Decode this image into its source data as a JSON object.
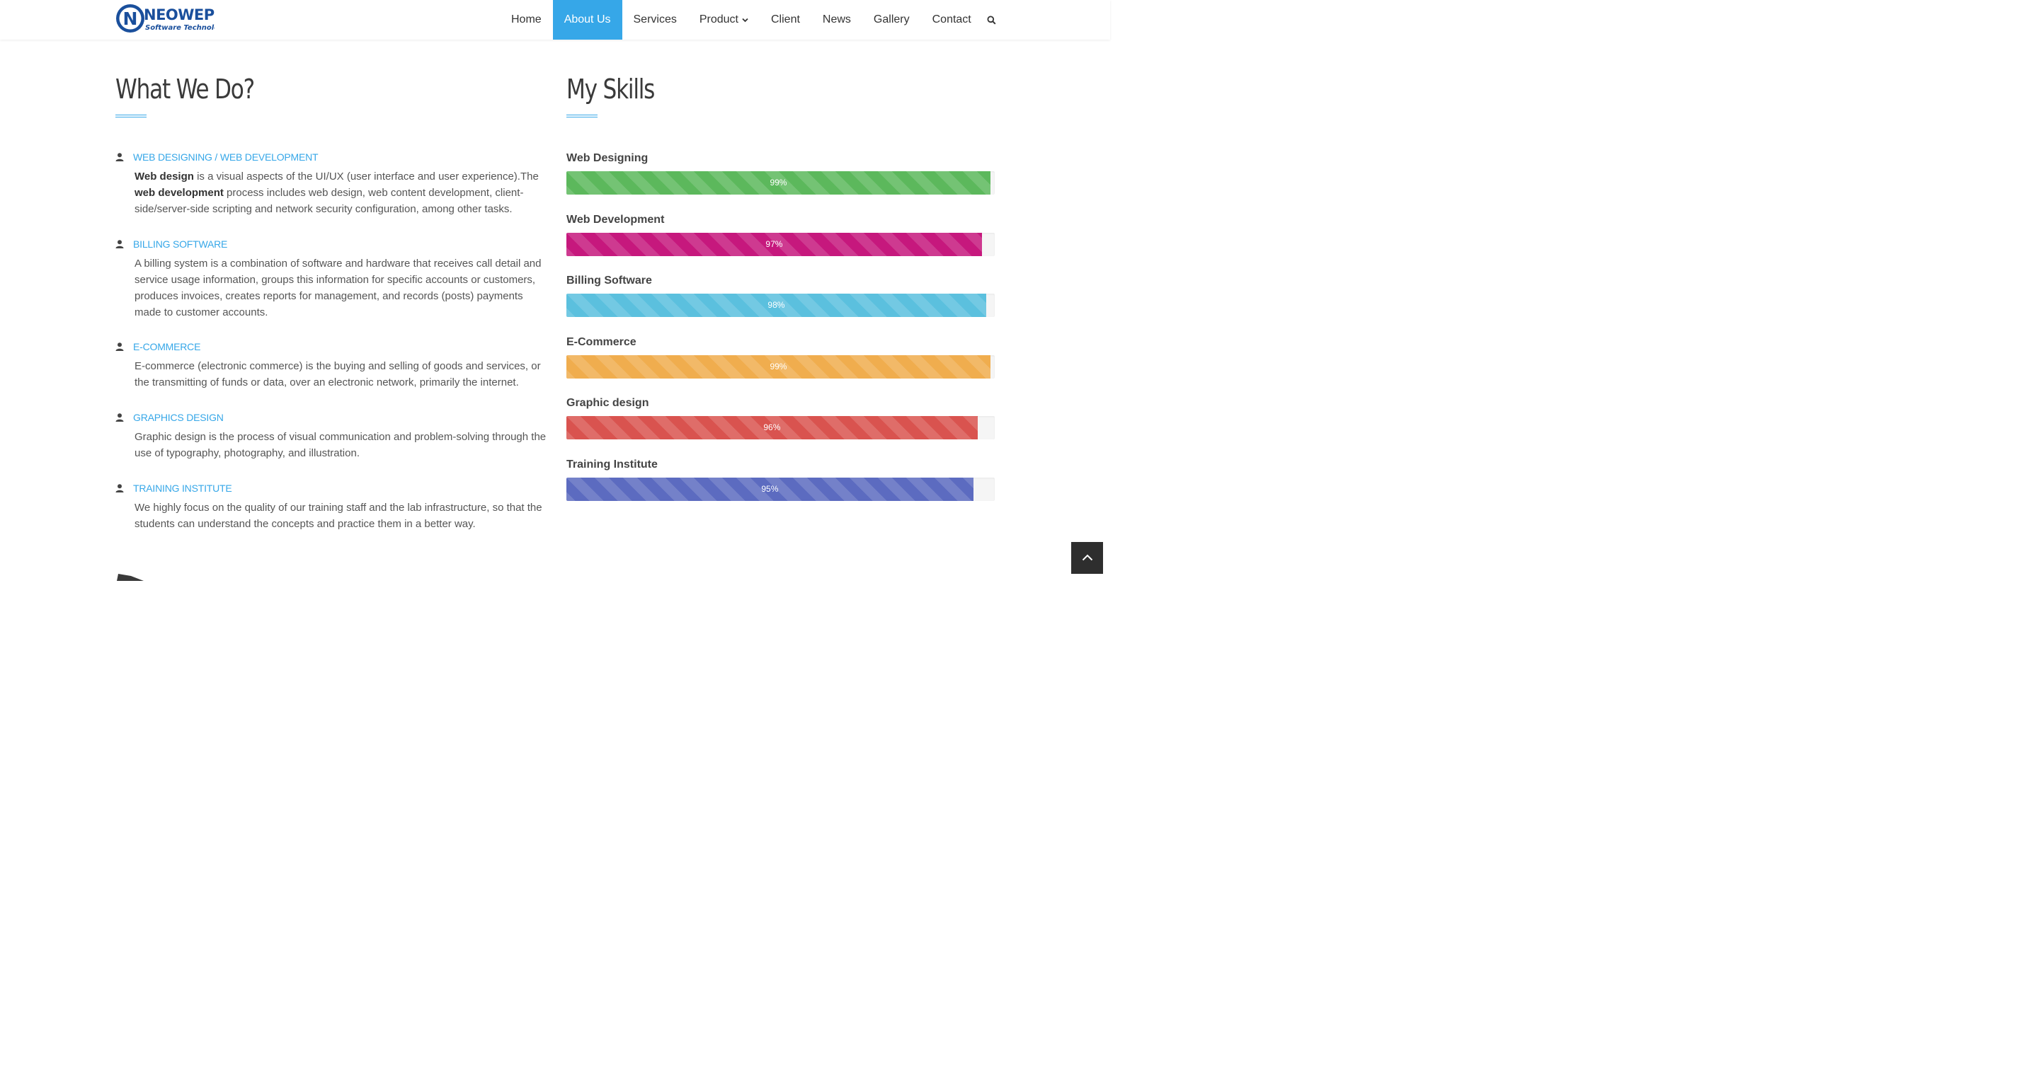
{
  "brand": {
    "name": "NEOWEP",
    "tagline": "Software Technology",
    "color": "#1a4f9c"
  },
  "nav": {
    "items": [
      {
        "label": "Home"
      },
      {
        "label": "About Us"
      },
      {
        "label": "Services"
      },
      {
        "label": "Product"
      },
      {
        "label": "Client"
      },
      {
        "label": "News"
      },
      {
        "label": "Gallery"
      },
      {
        "label": "Contact"
      }
    ],
    "active": "About Us",
    "active_color": "#36a7e8",
    "search_icon": "search-icon"
  },
  "what_we_do": {
    "title": "What We Do?",
    "items": [
      {
        "title": "WEB DESIGNING / WEB DEVELOPMENT",
        "desc_parts": [
          {
            "bold": "Web design"
          },
          {
            "text": " is a visual aspects of the UI/UX (user interface and user experience).The "
          },
          {
            "bold": "web development"
          },
          {
            "text": " process includes web design, web content development, client-side/server-side scripting and network security configuration, among other tasks."
          }
        ]
      },
      {
        "title": "BILLING SOFTWARE",
        "desc": "A billing system is a combination of software and hardware that receives call detail and service usage information, groups this information for specific accounts or customers, produces invoices, creates reports for management, and records (posts) payments made to customer accounts."
      },
      {
        "title": "E-COMMERCE",
        "desc": "E-commerce (electronic commerce) is the buying and selling of goods and services, or the transmitting of funds or data, over an electronic network, primarily the internet."
      },
      {
        "title": "GRAPHICS DESIGN",
        "desc": "Graphic design is the process of visual communication and problem-solving through the use of typography, photography, and illustration."
      },
      {
        "title": "TRAINING INSTITUTE",
        "desc": "We highly focus on the quality of our training staff and the lab infrastructure, so that the students can understand the concepts and practice them in a better way."
      }
    ],
    "item_icon": "user-icon"
  },
  "skills": {
    "title": "My Skills",
    "items": [
      {
        "name": "Web Designing",
        "percent": 99,
        "label": "99%",
        "color": "#5cb85c"
      },
      {
        "name": "Web Development",
        "percent": 97,
        "label": "97%",
        "color": "#c6187d"
      },
      {
        "name": "Billing Software",
        "percent": 98,
        "label": "98%",
        "color": "#5bc0de"
      },
      {
        "name": "E-Commerce",
        "percent": 99,
        "label": "99%",
        "color": "#f0ad4e"
      },
      {
        "name": "Graphic design",
        "percent": 96,
        "label": "96%",
        "color": "#d9534f"
      },
      {
        "name": "Training Institute",
        "percent": 95,
        "label": "95%",
        "color": "#5c6bc0"
      }
    ]
  },
  "back_to_top_icon": "chevron-up-icon"
}
